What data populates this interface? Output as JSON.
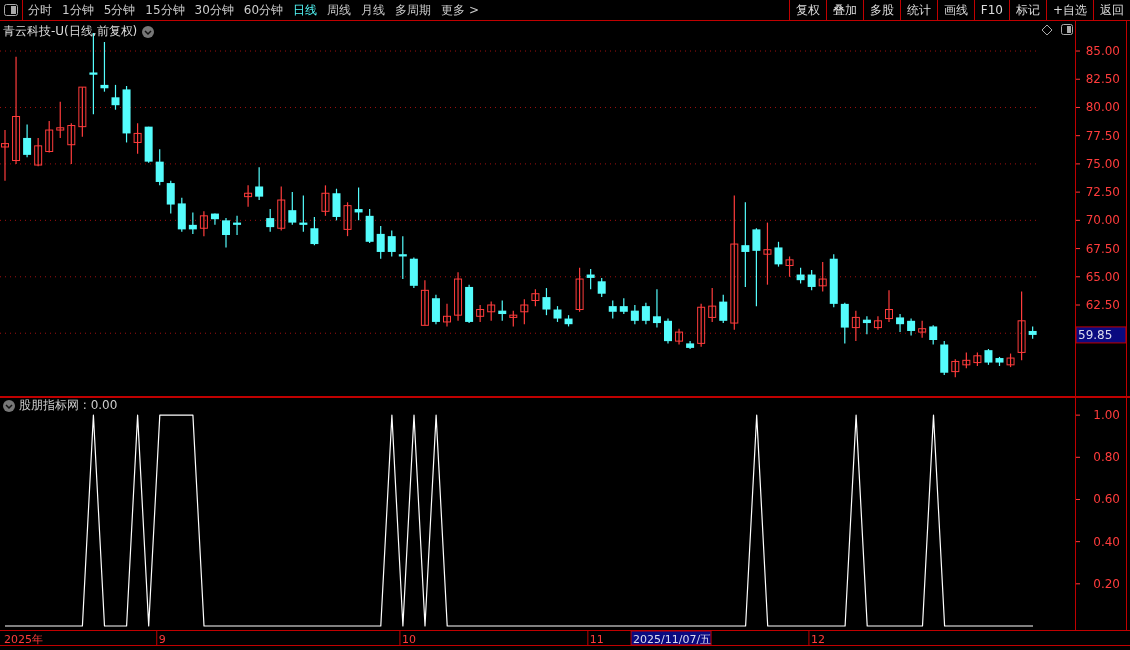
{
  "toolbar": {
    "periods": [
      {
        "label": "分时",
        "selected": false
      },
      {
        "label": "1分钟",
        "selected": false
      },
      {
        "label": "5分钟",
        "selected": false
      },
      {
        "label": "15分钟",
        "selected": false
      },
      {
        "label": "30分钟",
        "selected": false
      },
      {
        "label": "60分钟",
        "selected": false
      },
      {
        "label": "日线",
        "selected": true
      },
      {
        "label": "周线",
        "selected": false
      },
      {
        "label": "月线",
        "selected": false
      },
      {
        "label": "多周期",
        "selected": false
      },
      {
        "label": "更多 >",
        "selected": false
      }
    ],
    "actions": [
      "复权",
      "叠加",
      "多股",
      "统计",
      "画线",
      "F10",
      "标记",
      "+自选",
      "返回"
    ]
  },
  "price_panel": {
    "title": "青云科技-U(日线,前复权)",
    "last_price": "59.85",
    "chart_data": {
      "type": "candlestick",
      "categories": [
        null,
        null,
        null,
        null,
        null,
        null,
        null,
        null,
        null,
        null,
        null,
        null,
        null,
        null,
        null,
        null,
        null,
        null,
        null,
        null,
        null,
        null,
        null,
        null,
        null,
        null,
        null,
        null,
        null,
        null,
        null,
        null,
        null,
        null,
        null,
        null,
        null,
        null,
        null,
        null,
        null,
        null,
        null,
        null,
        null,
        null,
        null,
        null,
        null,
        null,
        null,
        null,
        null,
        null,
        null,
        null,
        null,
        null,
        null,
        null,
        null,
        null,
        null,
        null,
        null,
        null,
        null,
        null,
        null,
        null,
        null,
        null,
        null,
        null,
        null,
        null,
        null,
        null,
        null,
        null,
        null,
        null,
        null,
        null,
        null,
        null,
        null,
        null,
        null,
        null,
        null,
        null,
        null,
        null
      ],
      "ohlc": [
        [
          76.5,
          78,
          73.5,
          76.8
        ],
        [
          75.3,
          84.5,
          75,
          79.2
        ],
        [
          77.3,
          78.5,
          75.6,
          75.8
        ],
        [
          74.9,
          77.3,
          74.8,
          76.6
        ],
        [
          76.1,
          78.8,
          76,
          78
        ],
        [
          78,
          80.5,
          77.3,
          78.2
        ],
        [
          76.7,
          78.6,
          75,
          78.4
        ],
        [
          78.3,
          81.8,
          77.4,
          81.8
        ],
        [
          83.1,
          86.6,
          79.4,
          82.9
        ],
        [
          82,
          85.8,
          81.4,
          81.7
        ],
        [
          80.9,
          82,
          79.8,
          80.2
        ],
        [
          81.6,
          81.9,
          76.9,
          77.7
        ],
        [
          76.9,
          78.6,
          75.9,
          77.7
        ],
        [
          78.3,
          78.3,
          75.1,
          75.2
        ],
        [
          75.2,
          76.3,
          73.1,
          73.4
        ],
        [
          73.3,
          73.5,
          70.6,
          71.4
        ],
        [
          71.5,
          72,
          69,
          69.2
        ],
        [
          69.6,
          70.7,
          68.8,
          69.2
        ],
        [
          69.3,
          70.8,
          68.6,
          70.4
        ],
        [
          70.6,
          70.6,
          69.6,
          70.1
        ],
        [
          70,
          70.2,
          67.6,
          68.7
        ],
        [
          69.8,
          70.4,
          68.7,
          69.6
        ],
        [
          72.1,
          73.1,
          71.2,
          72.4
        ],
        [
          73,
          74.7,
          71.8,
          72.1
        ],
        [
          70.2,
          71,
          69,
          69.4
        ],
        [
          69.3,
          73,
          69.1,
          71.8
        ],
        [
          70.9,
          72.5,
          69.6,
          69.8
        ],
        [
          69.8,
          72.2,
          69,
          69.6
        ],
        [
          69.3,
          70.3,
          67.8,
          67.9
        ],
        [
          70.8,
          73.1,
          70.4,
          72.4
        ],
        [
          72.4,
          72.8,
          70,
          70.3
        ],
        [
          69.2,
          71.6,
          68.6,
          71.3
        ],
        [
          71,
          72.9,
          70,
          70.7
        ],
        [
          70.4,
          71,
          68,
          68.1
        ],
        [
          68.8,
          69.5,
          66.6,
          67.2
        ],
        [
          68.6,
          69.1,
          66.8,
          67.2
        ],
        [
          67,
          68.6,
          64.8,
          66.8
        ],
        [
          66.6,
          66.7,
          64,
          64.2
        ],
        [
          60.7,
          64.7,
          60.7,
          63.8
        ],
        [
          63.1,
          63.4,
          60.8,
          61
        ],
        [
          61,
          62.6,
          60.6,
          61.5
        ],
        [
          61.6,
          65.4,
          61.1,
          64.8
        ],
        [
          64.1,
          64.3,
          60.9,
          61
        ],
        [
          61.5,
          62.5,
          61,
          62.1
        ],
        [
          61.9,
          62.8,
          61.1,
          62.5
        ],
        [
          62,
          62.9,
          61.1,
          61.7
        ],
        [
          61.4,
          62,
          60.6,
          61.6
        ],
        [
          61.9,
          63,
          60.8,
          62.5
        ],
        [
          62.9,
          63.9,
          62.4,
          63.5
        ],
        [
          63.2,
          64,
          61.6,
          62.1
        ],
        [
          62.1,
          62.4,
          61,
          61.3
        ],
        [
          61.3,
          61.6,
          60.6,
          60.8
        ],
        [
          62.1,
          65.8,
          61.9,
          64.8
        ],
        [
          65.2,
          65.7,
          63.9,
          64.9
        ],
        [
          64.6,
          64.9,
          63.2,
          63.5
        ],
        [
          62.4,
          62.9,
          61.3,
          61.9
        ],
        [
          62.4,
          63.1,
          61.7,
          61.9
        ],
        [
          62,
          62.5,
          60.8,
          61.1
        ],
        [
          62.4,
          62.7,
          60.8,
          61.1
        ],
        [
          61.5,
          63.9,
          60.5,
          60.9
        ],
        [
          61.1,
          61.3,
          59.1,
          59.3
        ],
        [
          59.3,
          60.4,
          59,
          60.1
        ],
        [
          59.1,
          59.3,
          58.6,
          58.7
        ],
        [
          59.1,
          62.6,
          58.8,
          62.3
        ],
        [
          61.4,
          64,
          61,
          62.4
        ],
        [
          62.8,
          63.4,
          60.9,
          61.1
        ],
        [
          60.9,
          72.2,
          60.3,
          67.9
        ],
        [
          67.8,
          71.6,
          64.1,
          67.2
        ],
        [
          69.2,
          69.3,
          62.4,
          67.3
        ],
        [
          67,
          69.8,
          64.3,
          67.4
        ],
        [
          67.6,
          68.1,
          65.9,
          66.1
        ],
        [
          66,
          66.8,
          65,
          66.5
        ],
        [
          65.2,
          65.8,
          64.4,
          64.7
        ],
        [
          65.2,
          65.6,
          63.8,
          64.1
        ],
        [
          64.2,
          66.3,
          63.7,
          64.8
        ],
        [
          66.6,
          67,
          62.3,
          62.6
        ],
        [
          62.6,
          62.7,
          59.1,
          60.5
        ],
        [
          60.5,
          62,
          59.3,
          61.4
        ],
        [
          61.2,
          61.5,
          59.9,
          60.9
        ],
        [
          60.5,
          61.5,
          60.3,
          61.1
        ],
        [
          61.3,
          63.8,
          61,
          62.1
        ],
        [
          61.4,
          61.7,
          60.1,
          60.8
        ],
        [
          61.1,
          61.3,
          59.8,
          60.2
        ],
        [
          60.1,
          61.1,
          59.6,
          60.4
        ],
        [
          60.6,
          60.7,
          59,
          59.4
        ],
        [
          59,
          59.3,
          56.3,
          56.5
        ],
        [
          56.6,
          57.7,
          56.1,
          57.5
        ],
        [
          57.2,
          58.3,
          56.9,
          57.6
        ],
        [
          57.4,
          58.3,
          57.1,
          58
        ],
        [
          58.5,
          58.6,
          57.2,
          57.4
        ],
        [
          57.8,
          57.9,
          57.1,
          57.4
        ],
        [
          57.2,
          58.2,
          57,
          57.8
        ],
        [
          58.3,
          63.7,
          57.6,
          61.1
        ],
        [
          60.2,
          60.6,
          59.5,
          59.85
        ]
      ],
      "ylim": [
        54.35,
        87.66
      ],
      "grid": true,
      "yticks": [
        {
          "value": 85,
          "label": "85.00"
        },
        {
          "value": 82.5,
          "label": "82.50"
        },
        {
          "value": 80,
          "label": "80.00"
        },
        {
          "value": 77.5,
          "label": "77.50"
        },
        {
          "value": 75,
          "label": "75.00"
        },
        {
          "value": 72.5,
          "label": "72.50"
        },
        {
          "value": 70,
          "label": "70.00"
        },
        {
          "value": 67.5,
          "label": "67.50"
        },
        {
          "value": 65,
          "label": "65.00"
        },
        {
          "value": 62.5,
          "label": "62.50"
        }
      ]
    }
  },
  "indicator_panel": {
    "title": "股朋指标网 : 0.00",
    "chart_data": {
      "type": "line",
      "categories": [
        null,
        null,
        null,
        null,
        null,
        null,
        null,
        null,
        null,
        null,
        null,
        null,
        null,
        null,
        null,
        null,
        null,
        null,
        null,
        null,
        null,
        null,
        null,
        null,
        null,
        null,
        null,
        null,
        null,
        null,
        null,
        null,
        null,
        null,
        null,
        null,
        null,
        null,
        null,
        null,
        null,
        null,
        null,
        null,
        null,
        null,
        null,
        null,
        null,
        null,
        null,
        null,
        null,
        null,
        null,
        null,
        null,
        null,
        null,
        null,
        null,
        null,
        null,
        null,
        null,
        null,
        null,
        null,
        null,
        null,
        null,
        null,
        null,
        null,
        null,
        null,
        null,
        null,
        null,
        null,
        null,
        null,
        null,
        null,
        null,
        null,
        null,
        null,
        null,
        null,
        null,
        null,
        null,
        null
      ],
      "series": [
        {
          "color": "#ffffff",
          "values": [
            0,
            0,
            0,
            0,
            0,
            0,
            0,
            0,
            1,
            0,
            0,
            0,
            1,
            0,
            1,
            1,
            1,
            1,
            0,
            0,
            0,
            0,
            0,
            0,
            0,
            0,
            0,
            0,
            0,
            0,
            0,
            0,
            0,
            0,
            0,
            1,
            0,
            1,
            0,
            1,
            0,
            0,
            0,
            0,
            0,
            0,
            0,
            0,
            0,
            0,
            0,
            0,
            0,
            0,
            0,
            0,
            0,
            0,
            0,
            0,
            0,
            0,
            0,
            0,
            0,
            0,
            0,
            0,
            1,
            0,
            0,
            0,
            0,
            0,
            0,
            0,
            0,
            1,
            0,
            0,
            0,
            0,
            0,
            0,
            1,
            0,
            0,
            0,
            0,
            0,
            0,
            0,
            0,
            0
          ]
        }
      ],
      "ylim": [
        -0.019,
        1.086
      ],
      "yticks": [
        {
          "value": 0.2,
          "label": "0.20"
        },
        {
          "value": 0.4,
          "label": "0.40"
        },
        {
          "value": 0.6,
          "label": "0.60"
        },
        {
          "value": 0.8,
          "label": "0.80"
        },
        {
          "value": 1,
          "label": "1.00"
        }
      ]
    }
  },
  "date_axis": {
    "labels": [
      "2025年",
      "9",
      "10",
      "11",
      "12"
    ],
    "cursor_date": "2025/11/07/五"
  }
}
